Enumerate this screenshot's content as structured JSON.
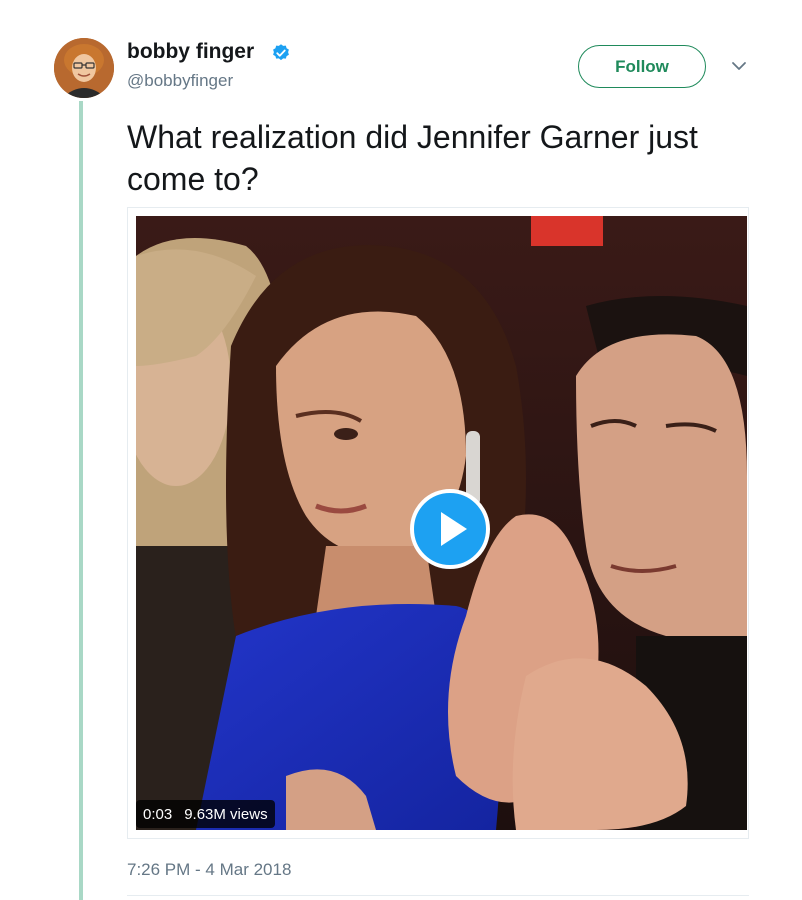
{
  "author": {
    "display_name": "bobby finger",
    "handle": "@bobbyfinger",
    "avatar_icon": "profile-photo",
    "verified_icon": "verified-badge-icon"
  },
  "follow_label": "Follow",
  "more_icon": "chevron-down-icon",
  "tweet": {
    "text": "What realization did Jennifer Garner just come to?",
    "timestamp": "7:26 PM - 4 Mar 2018"
  },
  "video": {
    "duration": "0:03",
    "views": "9.63M views",
    "play_icon": "play-icon"
  },
  "colors": {
    "accent": "#1da1f2",
    "follow_green": "#1f8a5b",
    "thread_line": "#a9d8c6",
    "text_primary": "#14171a",
    "text_secondary": "#657786"
  }
}
